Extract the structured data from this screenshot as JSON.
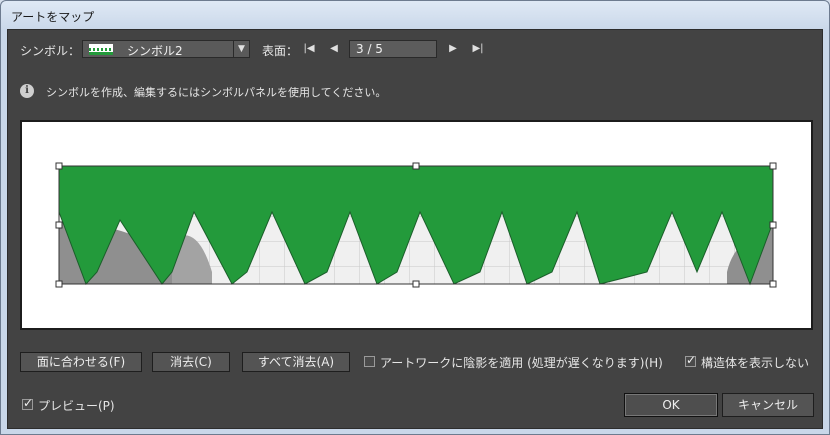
{
  "window": {
    "title": "アートをマップ"
  },
  "symbol": {
    "label": "シンボル：",
    "selected": "シンボル2"
  },
  "surface": {
    "label": "表面：",
    "value": "3 / 5",
    "first_icon": "first-page-icon",
    "prev_icon": "previous-page-icon",
    "next_icon": "next-page-icon",
    "last_icon": "last-page-icon"
  },
  "info": {
    "icon": "info-icon",
    "text": "シンボルを作成、編集するにはシンボルパネルを使用してください。"
  },
  "colors": {
    "symbol_green": "#239a3b",
    "dialog_bg": "#434343"
  },
  "buttons": {
    "fit_to_face": "面に合わせる(F)",
    "clear": "消去(C)",
    "clear_all": "すべて消去(A)",
    "ok": "OK",
    "cancel": "キャンセル"
  },
  "options": {
    "shade_label": "アートワークに陰影を適用 (処理が遅くなります)(H)",
    "shade_checked": false,
    "hide_geometry_label": "構造体を表示しない",
    "hide_geometry_checked": true,
    "preview_label": "プレビュー(P)",
    "preview_checked": true
  }
}
